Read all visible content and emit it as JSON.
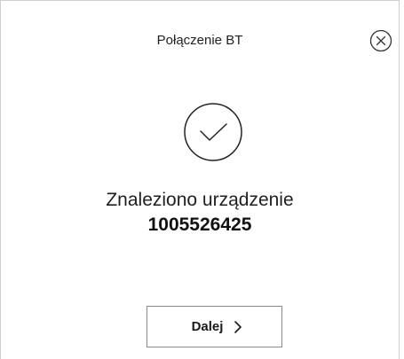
{
  "dialog": {
    "title": "Połączenie BT",
    "message": "Znaleziono urządzenie",
    "device_id": "1005526425",
    "next_label": "Dalej",
    "icons": {
      "close": "close-circle-icon",
      "success": "checkmark-circle-icon",
      "next": "chevron-right-icon"
    }
  }
}
